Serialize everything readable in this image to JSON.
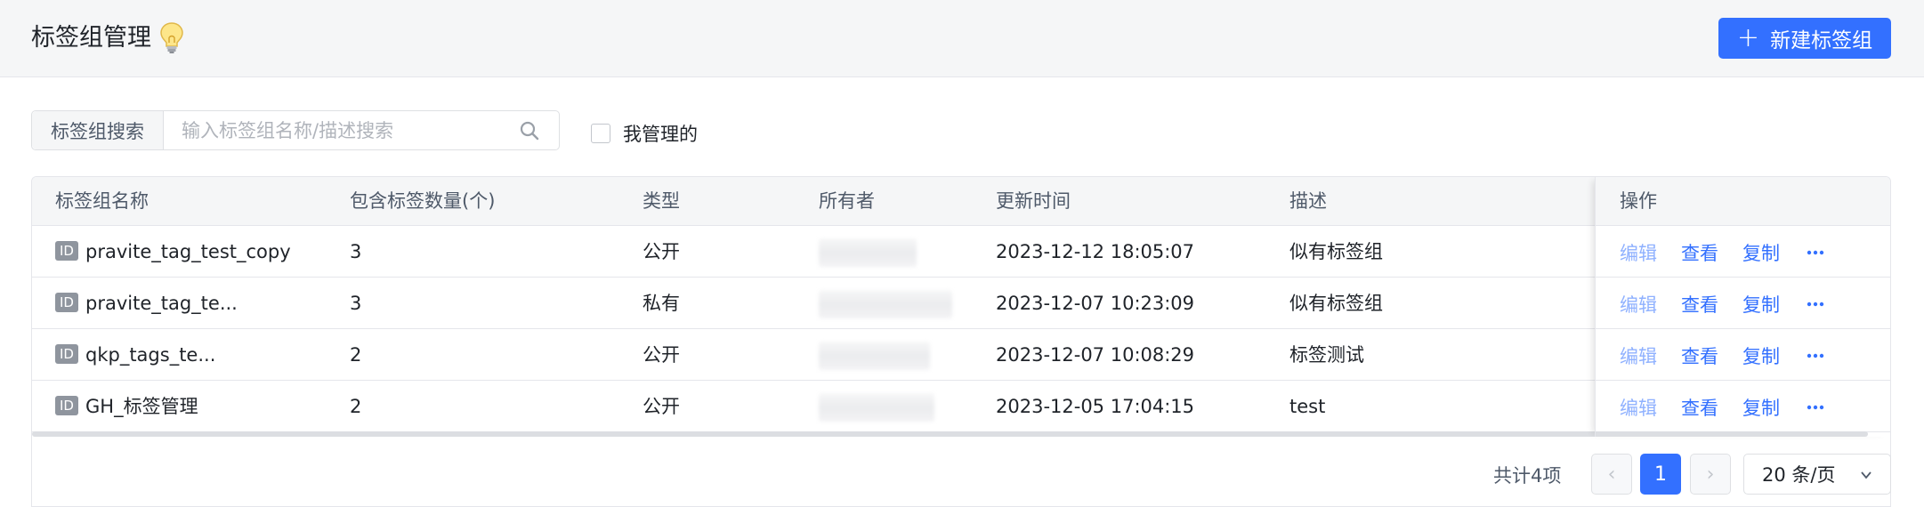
{
  "header": {
    "title": "标签组管理",
    "bulb_icon": "lightbulb-icon",
    "new_button_label": "新建标签组",
    "plus_symbol": "+",
    "accent_color": "#3370ff"
  },
  "search": {
    "label": "标签组搜索",
    "placeholder": "输入标签组名称/描述搜索",
    "value": "",
    "icon": "search-icon"
  },
  "filter": {
    "mine_label": "我管理的",
    "mine_checked": false
  },
  "table": {
    "columns": [
      "标签组名称",
      "包含标签数量(个)",
      "类型",
      "所有者",
      "更新时间",
      "描述",
      "操作"
    ],
    "id_badge": "ID",
    "rows": [
      {
        "name": "pravite_tag_test_copy",
        "count": "3",
        "type": "公开",
        "owner": "",
        "updated": "2023-12-12 18:05:07",
        "desc": "似有标签组"
      },
      {
        "name": "pravite_tag_te...",
        "count": "3",
        "type": "私有",
        "owner": "",
        "updated": "2023-12-07 10:23:09",
        "desc": "似有标签组"
      },
      {
        "name": "qkp_tags_te...",
        "count": "2",
        "type": "公开",
        "owner": "",
        "updated": "2023-12-07 10:08:29",
        "desc": "标签测试"
      },
      {
        "name": "GH_标签管理",
        "count": "2",
        "type": "公开",
        "owner": "",
        "updated": "2023-12-05 17:04:15",
        "desc": "test"
      }
    ],
    "actions": {
      "edit": "编辑",
      "view": "查看",
      "copy": "复制",
      "more": "more-icon"
    }
  },
  "pagination": {
    "total_text": "共计4项",
    "prev": "‹",
    "current_page": "1",
    "next": "›",
    "page_size": "20 条/页"
  }
}
